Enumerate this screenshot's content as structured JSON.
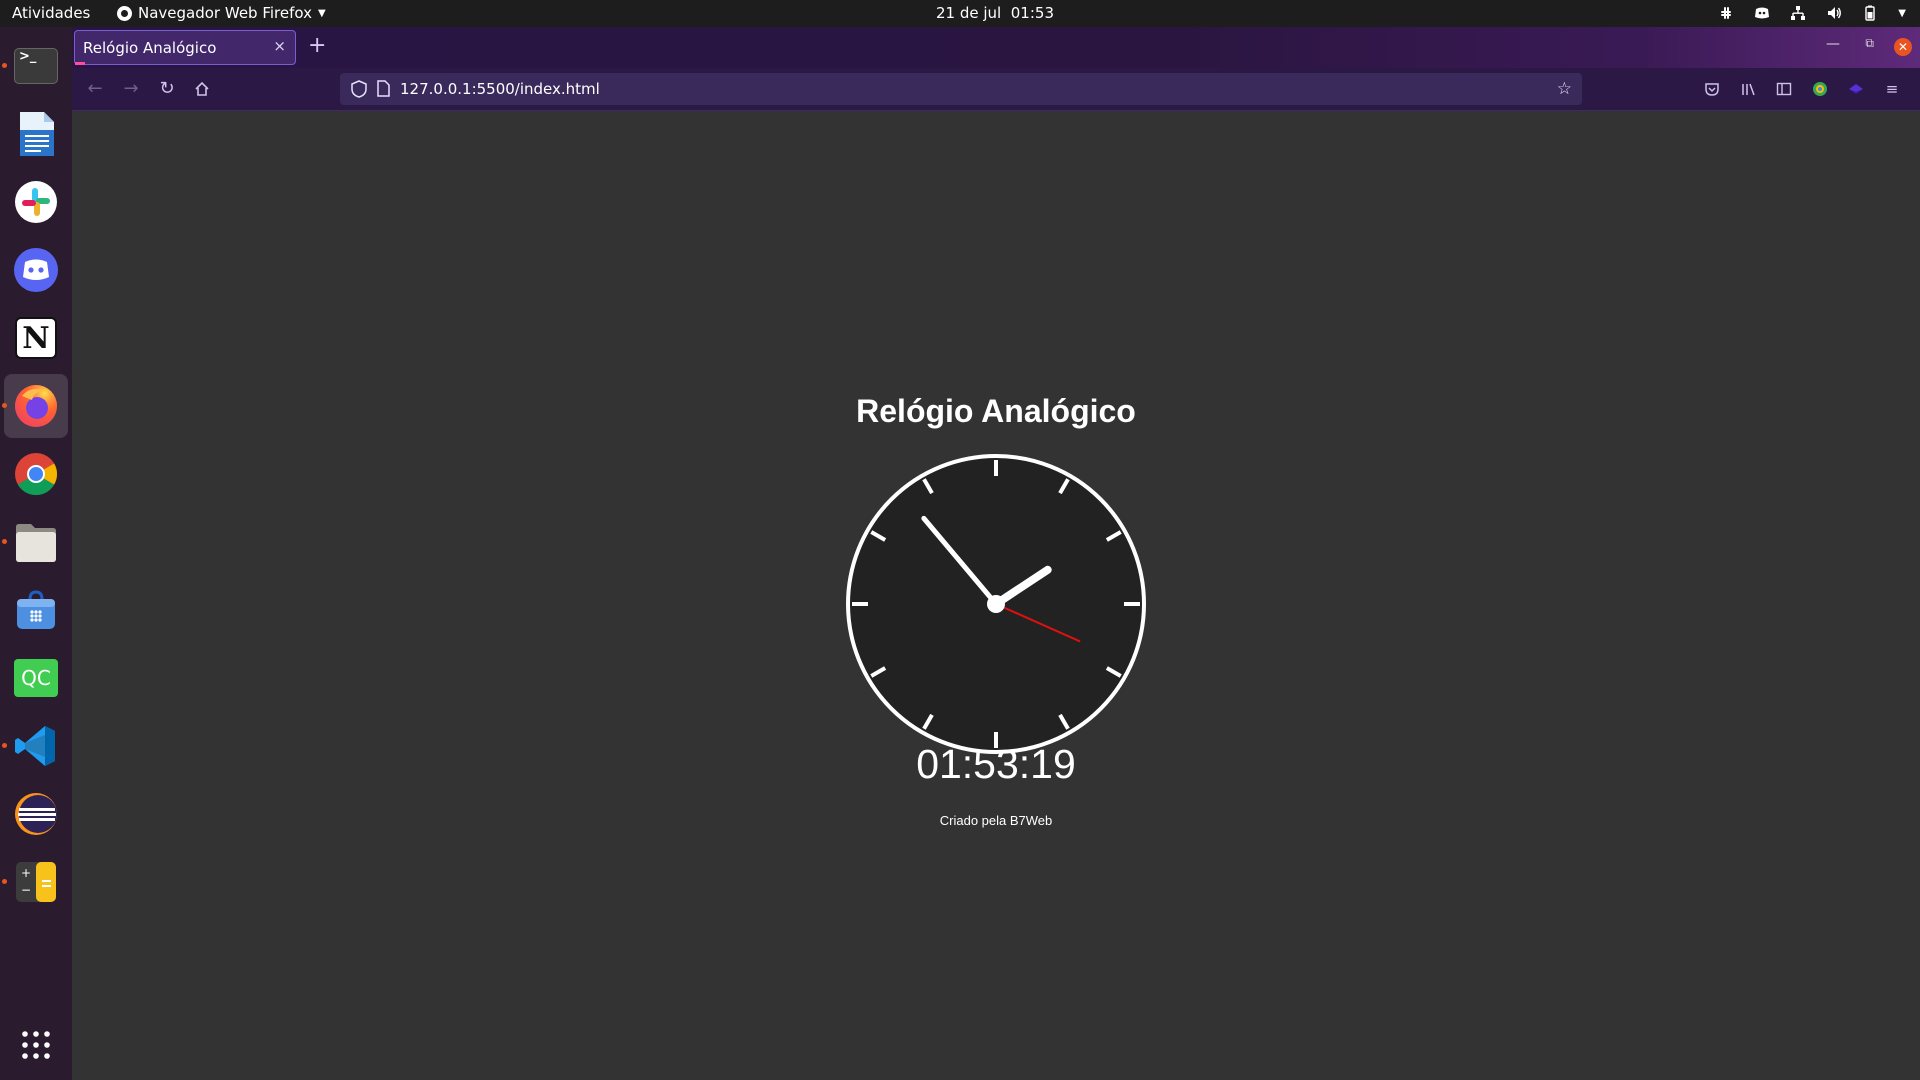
{
  "topbar": {
    "activities": "Atividades",
    "app_name": "Navegador Web Firefox",
    "date": "21 de jul",
    "time": "01:53"
  },
  "dock": {
    "items": [
      {
        "name": "terminal",
        "running": true
      },
      {
        "name": "libreoffice-writer",
        "running": false
      },
      {
        "name": "slack",
        "running": false
      },
      {
        "name": "discord",
        "running": false
      },
      {
        "name": "notion",
        "running": false
      },
      {
        "name": "firefox",
        "running": true,
        "active": true
      },
      {
        "name": "chrome",
        "running": false
      },
      {
        "name": "files",
        "running": true
      },
      {
        "name": "software-store",
        "running": false
      },
      {
        "name": "qt-creator",
        "running": false
      },
      {
        "name": "vscode",
        "running": true
      },
      {
        "name": "eclipse",
        "running": false
      },
      {
        "name": "calculator",
        "running": true
      }
    ],
    "show_apps_icon": "app-grid-icon"
  },
  "browser": {
    "tab": {
      "title": "Relógio Analógico",
      "close": "×"
    },
    "new_tab": "+",
    "url": "127.0.0.1:5500/index.html"
  },
  "page": {
    "title": "Relógio Analógico",
    "digital_time": "01:53:19",
    "footer": "Criado pela B7Web"
  },
  "clock": {
    "hours": 1,
    "minutes": 53,
    "seconds": 19,
    "face_color": "#222222",
    "outline_color": "#ffffff",
    "second_hand_color": "#dd1111"
  },
  "colors": {
    "page_background": "#333333",
    "tab_border": "#7f5bd0",
    "toolbar_background": "#2b1845",
    "dock_background": "#2b1b2e",
    "accent_orange": "#e95420"
  }
}
